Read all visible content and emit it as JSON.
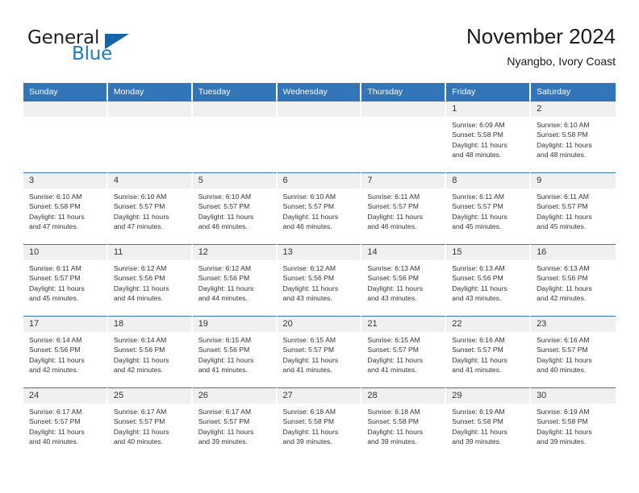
{
  "brand": {
    "word_one": "General",
    "word_two": "Blue",
    "logo_icon": "triangle-flag-icon"
  },
  "header": {
    "title": "November 2024",
    "subtitle": "Nyangbo, Ivory Coast"
  },
  "colors": {
    "header_blue": "#3275b8",
    "brand_blue": "#1c7bc4",
    "daynum_band": "#f0f0f0",
    "text": "#333333"
  },
  "weekdays": [
    "Sunday",
    "Monday",
    "Tuesday",
    "Wednesday",
    "Thursday",
    "Friday",
    "Saturday"
  ],
  "weeks": [
    [
      {
        "day": "",
        "lines": []
      },
      {
        "day": "",
        "lines": []
      },
      {
        "day": "",
        "lines": []
      },
      {
        "day": "",
        "lines": []
      },
      {
        "day": "",
        "lines": []
      },
      {
        "day": "1",
        "lines": [
          "Sunrise: 6:09 AM",
          "Sunset: 5:58 PM",
          "Daylight: 11 hours",
          "and 48 minutes."
        ]
      },
      {
        "day": "2",
        "lines": [
          "Sunrise: 6:10 AM",
          "Sunset: 5:58 PM",
          "Daylight: 11 hours",
          "and 48 minutes."
        ]
      }
    ],
    [
      {
        "day": "3",
        "lines": [
          "Sunrise: 6:10 AM",
          "Sunset: 5:58 PM",
          "Daylight: 11 hours",
          "and 47 minutes."
        ]
      },
      {
        "day": "4",
        "lines": [
          "Sunrise: 6:10 AM",
          "Sunset: 5:57 PM",
          "Daylight: 11 hours",
          "and 47 minutes."
        ]
      },
      {
        "day": "5",
        "lines": [
          "Sunrise: 6:10 AM",
          "Sunset: 5:57 PM",
          "Daylight: 11 hours",
          "and 46 minutes."
        ]
      },
      {
        "day": "6",
        "lines": [
          "Sunrise: 6:10 AM",
          "Sunset: 5:57 PM",
          "Daylight: 11 hours",
          "and 46 minutes."
        ]
      },
      {
        "day": "7",
        "lines": [
          "Sunrise: 6:11 AM",
          "Sunset: 5:57 PM",
          "Daylight: 11 hours",
          "and 46 minutes."
        ]
      },
      {
        "day": "8",
        "lines": [
          "Sunrise: 6:11 AM",
          "Sunset: 5:57 PM",
          "Daylight: 11 hours",
          "and 45 minutes."
        ]
      },
      {
        "day": "9",
        "lines": [
          "Sunrise: 6:11 AM",
          "Sunset: 5:57 PM",
          "Daylight: 11 hours",
          "and 45 minutes."
        ]
      }
    ],
    [
      {
        "day": "10",
        "lines": [
          "Sunrise: 6:11 AM",
          "Sunset: 5:57 PM",
          "Daylight: 11 hours",
          "and 45 minutes."
        ]
      },
      {
        "day": "11",
        "lines": [
          "Sunrise: 6:12 AM",
          "Sunset: 5:56 PM",
          "Daylight: 11 hours",
          "and 44 minutes."
        ]
      },
      {
        "day": "12",
        "lines": [
          "Sunrise: 6:12 AM",
          "Sunset: 5:56 PM",
          "Daylight: 11 hours",
          "and 44 minutes."
        ]
      },
      {
        "day": "13",
        "lines": [
          "Sunrise: 6:12 AM",
          "Sunset: 5:56 PM",
          "Daylight: 11 hours",
          "and 43 minutes."
        ]
      },
      {
        "day": "14",
        "lines": [
          "Sunrise: 6:13 AM",
          "Sunset: 5:56 PM",
          "Daylight: 11 hours",
          "and 43 minutes."
        ]
      },
      {
        "day": "15",
        "lines": [
          "Sunrise: 6:13 AM",
          "Sunset: 5:56 PM",
          "Daylight: 11 hours",
          "and 43 minutes."
        ]
      },
      {
        "day": "16",
        "lines": [
          "Sunrise: 6:13 AM",
          "Sunset: 5:56 PM",
          "Daylight: 11 hours",
          "and 42 minutes."
        ]
      }
    ],
    [
      {
        "day": "17",
        "lines": [
          "Sunrise: 6:14 AM",
          "Sunset: 5:56 PM",
          "Daylight: 11 hours",
          "and 42 minutes."
        ]
      },
      {
        "day": "18",
        "lines": [
          "Sunrise: 6:14 AM",
          "Sunset: 5:56 PM",
          "Daylight: 11 hours",
          "and 42 minutes."
        ]
      },
      {
        "day": "19",
        "lines": [
          "Sunrise: 6:15 AM",
          "Sunset: 5:56 PM",
          "Daylight: 11 hours",
          "and 41 minutes."
        ]
      },
      {
        "day": "20",
        "lines": [
          "Sunrise: 6:15 AM",
          "Sunset: 5:57 PM",
          "Daylight: 11 hours",
          "and 41 minutes."
        ]
      },
      {
        "day": "21",
        "lines": [
          "Sunrise: 6:15 AM",
          "Sunset: 5:57 PM",
          "Daylight: 11 hours",
          "and 41 minutes."
        ]
      },
      {
        "day": "22",
        "lines": [
          "Sunrise: 6:16 AM",
          "Sunset: 5:57 PM",
          "Daylight: 11 hours",
          "and 41 minutes."
        ]
      },
      {
        "day": "23",
        "lines": [
          "Sunrise: 6:16 AM",
          "Sunset: 5:57 PM",
          "Daylight: 11 hours",
          "and 40 minutes."
        ]
      }
    ],
    [
      {
        "day": "24",
        "lines": [
          "Sunrise: 6:17 AM",
          "Sunset: 5:57 PM",
          "Daylight: 11 hours",
          "and 40 minutes."
        ]
      },
      {
        "day": "25",
        "lines": [
          "Sunrise: 6:17 AM",
          "Sunset: 5:57 PM",
          "Daylight: 11 hours",
          "and 40 minutes."
        ]
      },
      {
        "day": "26",
        "lines": [
          "Sunrise: 6:17 AM",
          "Sunset: 5:57 PM",
          "Daylight: 11 hours",
          "and 39 minutes."
        ]
      },
      {
        "day": "27",
        "lines": [
          "Sunrise: 6:18 AM",
          "Sunset: 5:58 PM",
          "Daylight: 11 hours",
          "and 39 minutes."
        ]
      },
      {
        "day": "28",
        "lines": [
          "Sunrise: 6:18 AM",
          "Sunset: 5:58 PM",
          "Daylight: 11 hours",
          "and 39 minutes."
        ]
      },
      {
        "day": "29",
        "lines": [
          "Sunrise: 6:19 AM",
          "Sunset: 5:58 PM",
          "Daylight: 11 hours",
          "and 39 minutes."
        ]
      },
      {
        "day": "30",
        "lines": [
          "Sunrise: 6:19 AM",
          "Sunset: 5:58 PM",
          "Daylight: 11 hours",
          "and 39 minutes."
        ]
      }
    ]
  ]
}
